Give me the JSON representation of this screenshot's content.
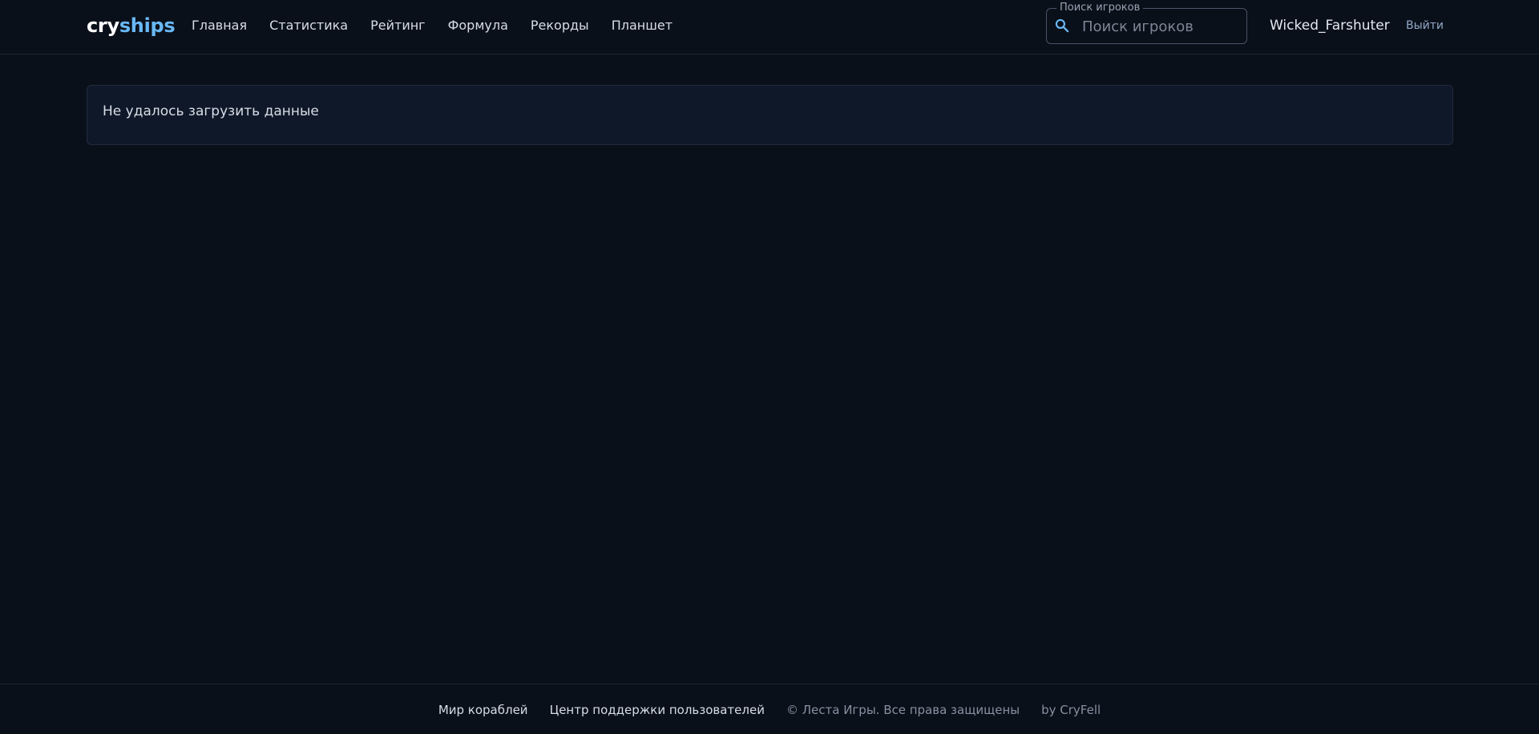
{
  "header": {
    "logo": {
      "part1": "cry",
      "part2": "ships"
    },
    "nav": [
      {
        "label": "Главная"
      },
      {
        "label": "Статистика"
      },
      {
        "label": "Рейтинг"
      },
      {
        "label": "Формула"
      },
      {
        "label": "Рекорды"
      },
      {
        "label": "Планшет"
      }
    ],
    "search": {
      "legend": "Поиск игроков",
      "placeholder": "Поиск игроков",
      "value": ""
    },
    "username": "Wicked_Farshuter",
    "logout_label": "Выйти"
  },
  "main": {
    "error_message": "Не удалось загрузить данные"
  },
  "footer": {
    "links": [
      {
        "label": "Мир кораблей"
      },
      {
        "label": "Центр поддержки пользователей"
      }
    ],
    "copyright": "© Леста Игры. Все права защищены",
    "author": "by CryFell"
  },
  "colors": {
    "background": "#0a101a",
    "accent": "#69b8f5",
    "card": "#0f1828"
  }
}
